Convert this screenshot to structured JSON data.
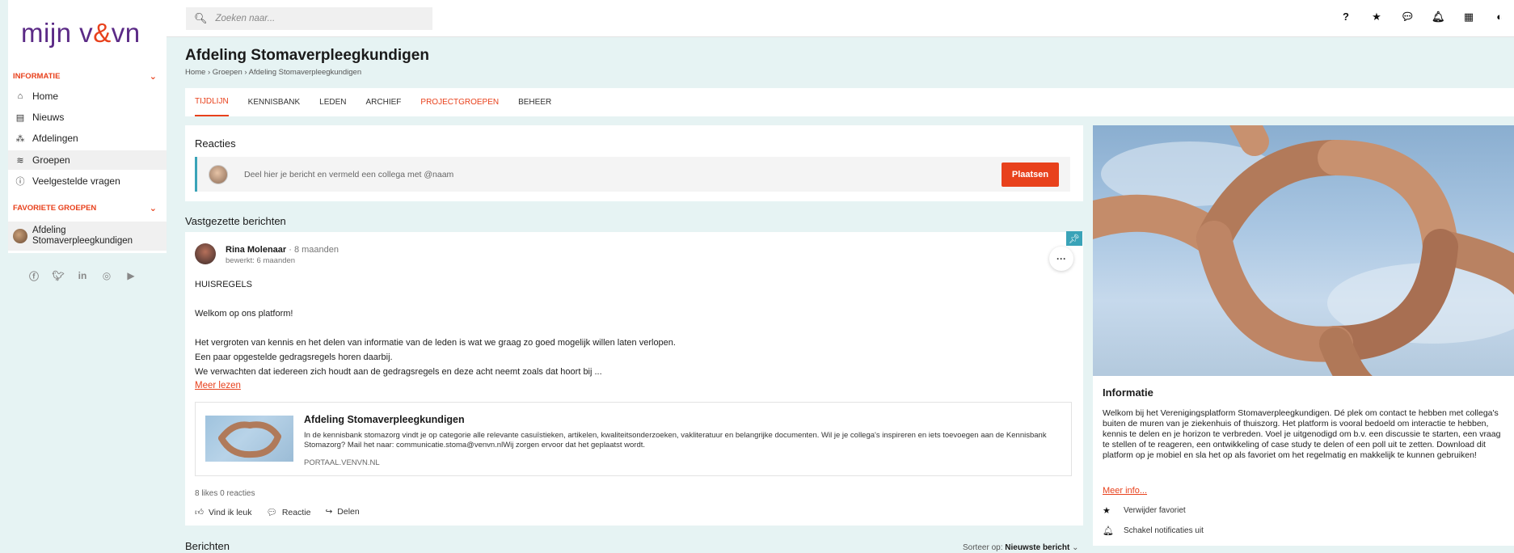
{
  "logo": {
    "part1": "mijn v",
    "amp": "&",
    "part2": "vn"
  },
  "sidebar": {
    "section_info": "INFORMATIE",
    "items": [
      {
        "label": "Home",
        "icon": "home-icon"
      },
      {
        "label": "Nieuws",
        "icon": "news-icon"
      },
      {
        "label": "Afdelingen",
        "icon": "sitemap-icon"
      },
      {
        "label": "Groepen",
        "icon": "layers-icon"
      },
      {
        "label": "Veelgestelde vragen",
        "icon": "question-circle-icon"
      }
    ],
    "section_fav": "FAVORIETE GROEPEN",
    "fav_group": {
      "line1": "Afdeling",
      "line2": "Stomaverpleegkundigen"
    }
  },
  "search": {
    "placeholder": "Zoeken naar..."
  },
  "page": {
    "title": "Afdeling Stomaverpleegkundigen",
    "breadcrumb": "Home › Groepen › Afdeling Stomaverpleegkundigen"
  },
  "tabs": [
    "TIJDLIJN",
    "KENNISBANK",
    "LEDEN",
    "ARCHIEF",
    "PROJECTGROEPEN",
    "BEHEER"
  ],
  "reacties": {
    "title": "Reacties",
    "placeholder": "Deel hier je bericht en vermeld een collega met @naam",
    "button": "Plaatsen"
  },
  "pinned_label": "Vastgezette berichten",
  "post": {
    "author": "Rina Molenaar",
    "time": "· 8 maanden",
    "edited": "bewerkt: 6 maanden",
    "heading": "HUISREGELS",
    "p1": "Welkom op ons platform!",
    "p2": "Het vergroten van kennis en het delen van informatie van de leden is wat we graag zo goed mogelijk willen laten verlopen.",
    "p3": "Een paar opgestelde gedragsregels horen daarbij.",
    "p4": "We verwachten dat iedereen zich houdt aan de gedragsregels en deze acht neemt zoals dat hoort bij ...",
    "read_more": "Meer lezen",
    "preview_title": "Afdeling Stomaverpleegkundigen",
    "preview_desc": "In de kennisbank stomazorg vindt je op categorie alle relevante casuïstieken, artikelen, kwaliteitsonderzoeken, vakliteratuur en belangrijke documenten. Wil je je collega's inspireren en iets toevoegen aan de Kennisbank Stomazorg? Mail het naar: communicatie.stoma@venvn.nlWij zorgen ervoor dat het geplaatst wordt.",
    "preview_src": "PORTAAL.VENVN.NL",
    "stats": "8 likes  0 reacties",
    "actions": [
      "Vind ik leuk",
      "Reactie",
      "Delen"
    ]
  },
  "berichten": {
    "title": "Berichten",
    "sort_label": "Sorteer op:",
    "sort_value": "Nieuwste bericht"
  },
  "info": {
    "title": "Informatie",
    "text": "Welkom bij het Verenigingsplatform Stomaverpleegkundigen. Dé plek om contact te hebben met collega's buiten de muren van je ziekenhuis of thuiszorg. Het platform is vooral bedoeld om interactie te hebben, kennis te delen en je horizon te verbreden. Voel je uitgenodigd om b.v. een discussie te starten, een vraag te stellen of te reageren, een ontwikkeling of case study te delen of een poll uit te zetten. Download dit platform op je mobiel en sla het op als favoriet om het regelmatig en makkelijk te kunnen gebruiken!",
    "more": "Meer info...",
    "fav_action": "Verwijder favoriet",
    "notif_action": "Schakel notificaties uit"
  },
  "colors": {
    "accent": "#e8411c",
    "brand": "#5b2a86",
    "teal": "#3aa3b8",
    "bg": "#e6f3f3"
  }
}
